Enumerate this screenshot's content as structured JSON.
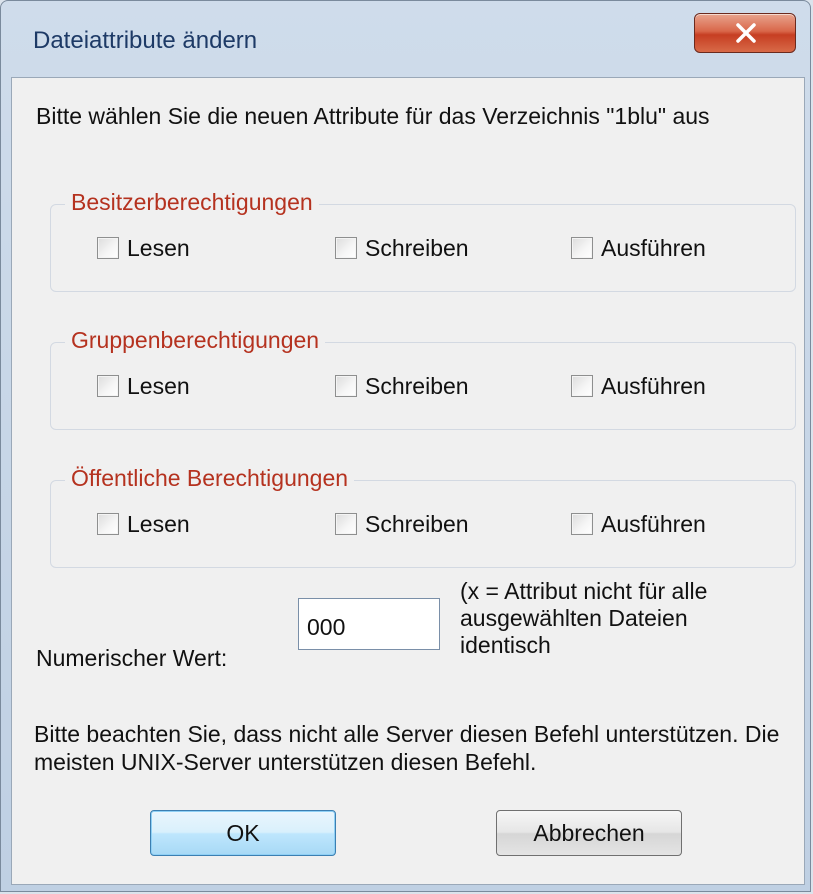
{
  "window": {
    "title": "Dateiattribute ändern",
    "close_icon": "close-x"
  },
  "intro_text": "Bitte wählen Sie die neuen Attribute für das Verzeichnis \"1blu\" aus",
  "groups": [
    {
      "title": "Besitzerberechtigungen",
      "options": [
        "Lesen",
        "Schreiben",
        "Ausführen"
      ],
      "checked": [
        false,
        false,
        false
      ]
    },
    {
      "title": "Gruppenberechtigungen",
      "options": [
        "Lesen",
        "Schreiben",
        "Ausführen"
      ],
      "checked": [
        false,
        false,
        false
      ]
    },
    {
      "title": "Öffentliche Berechtigungen",
      "options": [
        "Lesen",
        "Schreiben",
        "Ausführen"
      ],
      "checked": [
        false,
        false,
        false
      ]
    }
  ],
  "numeric": {
    "label": "Numerischer Wert:",
    "value": "000",
    "hint": "(x = Attribut nicht für alle ausgewählten Dateien identisch"
  },
  "note": "Bitte beachten Sie, dass nicht alle Server diesen Befehl unterstützen. Die meisten UNIX-Server unterstützen diesen Befehl.",
  "buttons": {
    "ok": "OK",
    "cancel": "Abbrechen"
  },
  "colors": {
    "group_title": "#b5321f",
    "title_text": "#1d3a66",
    "close_button": "#c63e22"
  }
}
